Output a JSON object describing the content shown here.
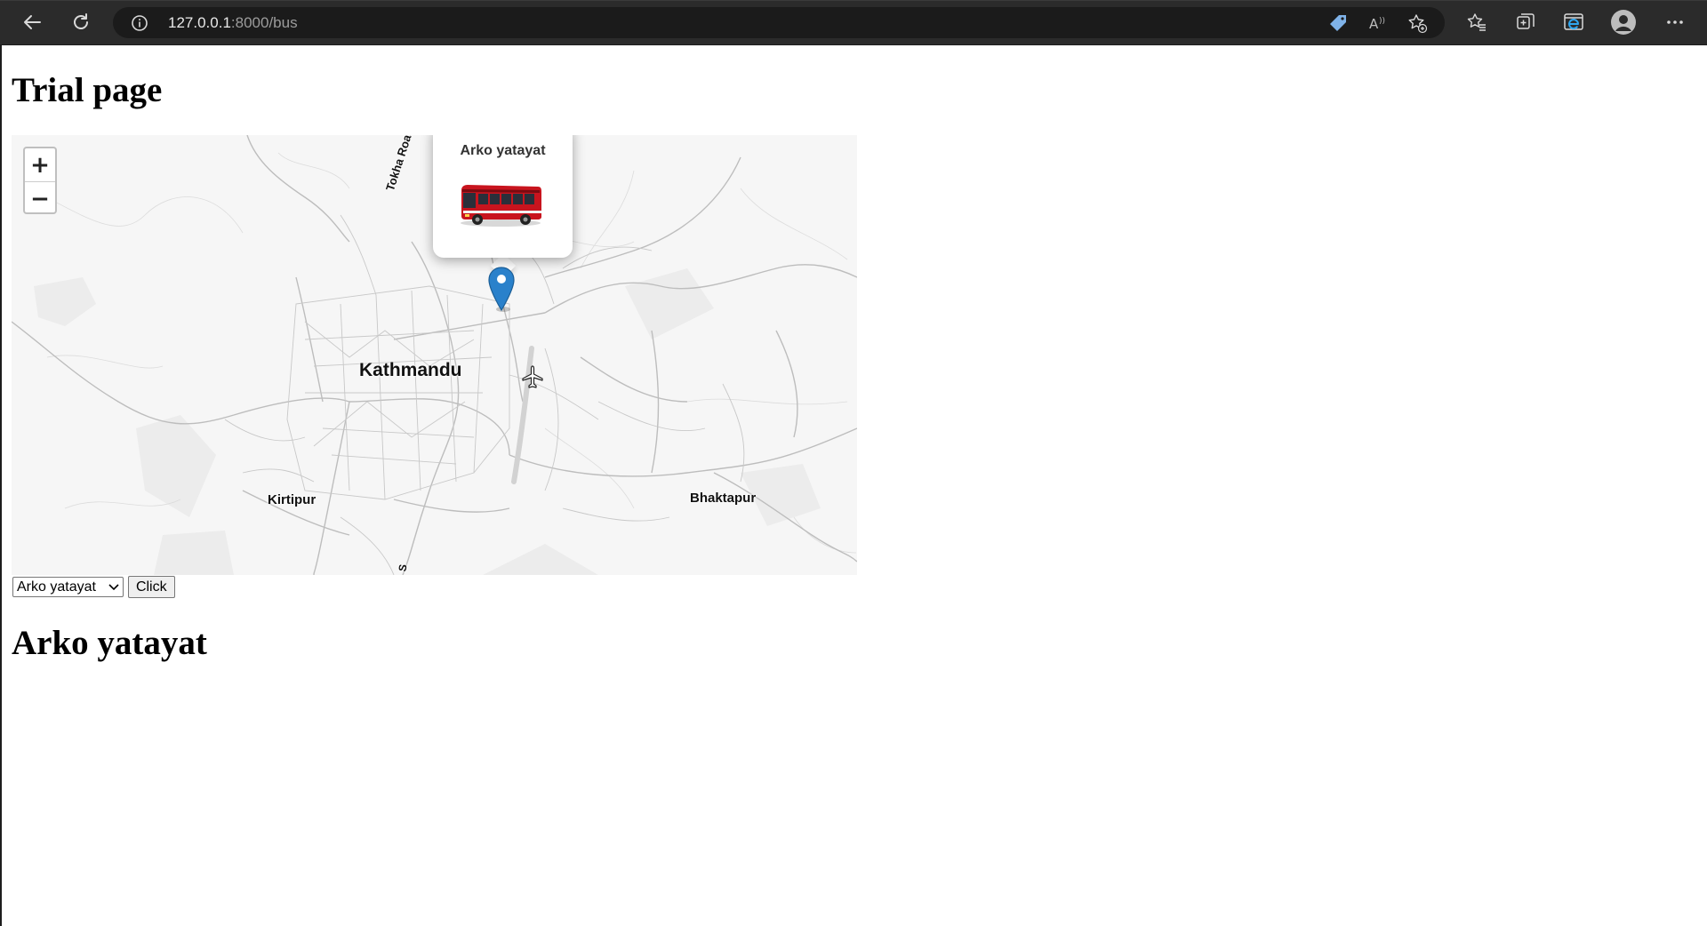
{
  "browser": {
    "url_host": "127.0.0.1",
    "url_path": ":8000/bus",
    "icons": [
      "back-arrow-icon",
      "refresh-icon",
      "info-icon",
      "tag-icon",
      "read-aloud-icon",
      "add-favorite-icon",
      "favorites-icon",
      "collections-icon",
      "edge-icon",
      "profile-icon",
      "more-icon"
    ]
  },
  "page": {
    "title": "Trial page",
    "result_heading": "Arko yatayat"
  },
  "map": {
    "zoom_in_label": "+",
    "zoom_out_label": "−",
    "labels": {
      "kathmandu": "Kathmandu",
      "kirtipur": "Kirtipur",
      "bhaktapur": "Bhaktapur",
      "tokha_road": "Tokha Road",
      "road_s": "S"
    },
    "popup": {
      "title": "Arko yatayat",
      "image": "bus-image"
    },
    "marker_color": "#2a81cb"
  },
  "controls": {
    "select_value": "Arko yatayat",
    "button_label": "Click"
  }
}
